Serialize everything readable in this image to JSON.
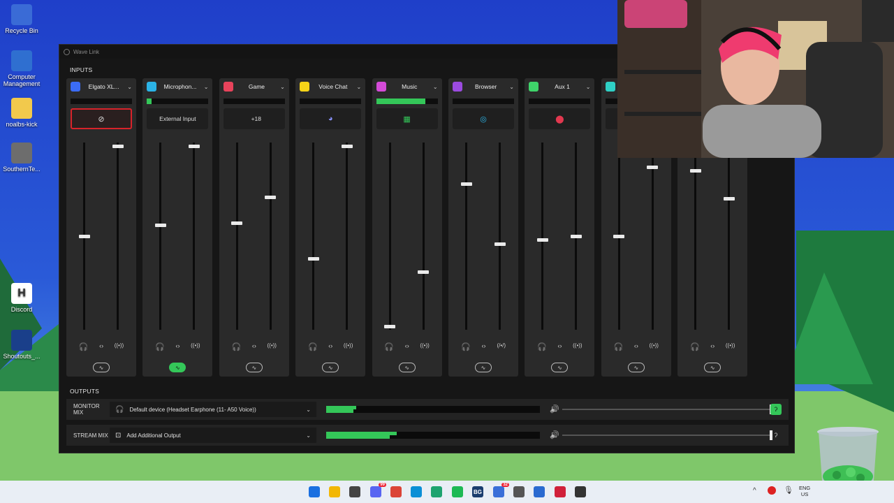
{
  "desktop": {
    "icons": [
      {
        "label": "Recycle Bin",
        "icon": "recycle-bin-icon"
      },
      {
        "label": "Computer Management",
        "icon": "computer-management-icon"
      },
      {
        "label": "noalbs-kick",
        "icon": "folder-icon"
      },
      {
        "label": "SouthernTe...",
        "icon": "thermometer-app-icon"
      },
      {
        "label": "Discord",
        "icon": "h-app-icon"
      },
      {
        "label": "Shoutouts_...",
        "icon": "shoutouts-app-icon"
      }
    ]
  },
  "window": {
    "title": "Wave Link",
    "inputs_label": "INPUTS",
    "outputs_label": "OUTPUTS"
  },
  "inputs": [
    {
      "name": "Elgato XL...",
      "chip_color": "#3b6cf5",
      "chip_icon": "mic-icon",
      "app_text": "",
      "app_icon": "mic-muted-icon",
      "muted": true,
      "meter": 0,
      "monitor_level": 0.5,
      "stream_level": 0.98,
      "fx_on": false,
      "monitor_icon": "headphones-muted-icon",
      "stream_icon": "broadcast-icon"
    },
    {
      "name": "Microphon...",
      "chip_color": "#2bb3e6",
      "chip_icon": "monitor-icon",
      "app_text": "External Input",
      "app_icon": "",
      "muted": false,
      "meter": 0.08,
      "monitor_level": 0.56,
      "stream_level": 0.98,
      "fx_on": true,
      "monitor_icon": "headphones-muted-icon",
      "stream_icon": "broadcast-icon"
    },
    {
      "name": "Game",
      "chip_color": "#e8435b",
      "chip_icon": "gamepad-icon",
      "app_text": "+18",
      "app_icon": "game-apps-icon",
      "muted": false,
      "meter": 0,
      "monitor_level": 0.57,
      "stream_level": 0.71,
      "fx_on": false,
      "monitor_icon": "headphones-icon",
      "stream_icon": "broadcast-icon"
    },
    {
      "name": "Voice Chat",
      "chip_color": "#f5d418",
      "chip_icon": "chat-bubble-icon",
      "app_text": "",
      "app_icon": "discord-icon",
      "muted": false,
      "meter": 0,
      "monitor_level": 0.38,
      "stream_level": 0.98,
      "fx_on": false,
      "monitor_icon": "headphones-icon",
      "stream_icon": "broadcast-icon"
    },
    {
      "name": "Music",
      "chip_color": "#d44bd8",
      "chip_icon": "music-note-icon",
      "app_text": "",
      "app_icon": "spotify-icon",
      "muted": false,
      "meter": 0.8,
      "monitor_level": 0.02,
      "stream_level": 0.31,
      "fx_on": false,
      "monitor_icon": "headphones-icon",
      "stream_icon": "broadcast-icon"
    },
    {
      "name": "Browser",
      "chip_color": "#9b4be0",
      "chip_icon": "browser-window-icon",
      "app_text": "",
      "app_icon": "edge-icon",
      "muted": false,
      "meter": 0,
      "monitor_level": 0.78,
      "stream_level": 0.46,
      "fx_on": false,
      "monitor_icon": "headphones-icon",
      "stream_icon": "broadcast-muted-icon"
    },
    {
      "name": "Aux 1",
      "chip_color": "#3fd36a",
      "chip_icon": "aux-icon",
      "app_text": "",
      "app_icon": "pin-icon",
      "muted": false,
      "meter": 0,
      "monitor_level": 0.48,
      "stream_level": 0.5,
      "fx_on": false,
      "monitor_icon": "headphones-icon",
      "stream_icon": "broadcast-icon"
    },
    {
      "name": "",
      "chip_color": "#2fd0c5",
      "chip_icon": "aux-icon",
      "app_text": "",
      "app_icon": "",
      "muted": false,
      "meter": 0,
      "monitor_level": 0.5,
      "stream_level": 0.87,
      "fx_on": false,
      "monitor_icon": "headphones-icon",
      "stream_icon": "broadcast-icon"
    },
    {
      "name": "",
      "chip_color": "#2a2a2a",
      "chip_icon": "",
      "app_text": "",
      "app_icon": "",
      "muted": false,
      "meter": 0,
      "monitor_level": 0.85,
      "stream_level": 0.7,
      "fx_on": false,
      "monitor_icon": "headphones-icon",
      "stream_icon": "broadcast-icon"
    }
  ],
  "outputs": [
    {
      "label": "MONITOR MIX",
      "device": "Default device (Headset Earphone (11- A50 Voice))",
      "device_icon": "headphones-icon",
      "meter": 0.14,
      "volume": 0.99,
      "ear_active": true
    },
    {
      "label": "STREAM MIX",
      "device": "Add Additional Output",
      "device_icon": "add-output-icon",
      "meter": 0.33,
      "volume": 0.99,
      "ear_active": false
    }
  ],
  "taskbar": {
    "apps": [
      {
        "icon": "windows-start-icon",
        "color": "#1a6fe0",
        "text": "",
        "badge": ""
      },
      {
        "icon": "file-explorer-icon",
        "color": "#f2b705",
        "text": "",
        "badge": ""
      },
      {
        "icon": "store-icon",
        "color": "#444",
        "text": "",
        "badge": ""
      },
      {
        "icon": "discord-icon",
        "color": "#5865f2",
        "text": "",
        "badge": "99"
      },
      {
        "icon": "chrome-icon",
        "color": "#db4437",
        "text": "",
        "badge": ""
      },
      {
        "icon": "edge-icon",
        "color": "#0b8fd6",
        "text": "",
        "badge": ""
      },
      {
        "icon": "app-icon",
        "color": "#1ea36f",
        "text": "",
        "badge": ""
      },
      {
        "icon": "spotify-icon",
        "color": "#1db954",
        "text": "",
        "badge": ""
      },
      {
        "icon": "bg-app-icon",
        "color": "#1a3d6e",
        "text": "BG",
        "badge": ""
      },
      {
        "icon": "stream-deck-icon",
        "color": "#3a6fd8",
        "text": "",
        "badge": "32"
      },
      {
        "icon": "ghost-app-icon",
        "color": "#555",
        "text": "",
        "badge": ""
      },
      {
        "icon": "mail-icon",
        "color": "#2a6ad0",
        "text": "",
        "badge": ""
      },
      {
        "icon": "record-app-icon",
        "color": "#d0203a",
        "text": "",
        "badge": ""
      },
      {
        "icon": "wave-link-icon",
        "color": "#333",
        "text": "",
        "badge": ""
      }
    ],
    "lang_line1": "ENG",
    "lang_line2": "US"
  }
}
